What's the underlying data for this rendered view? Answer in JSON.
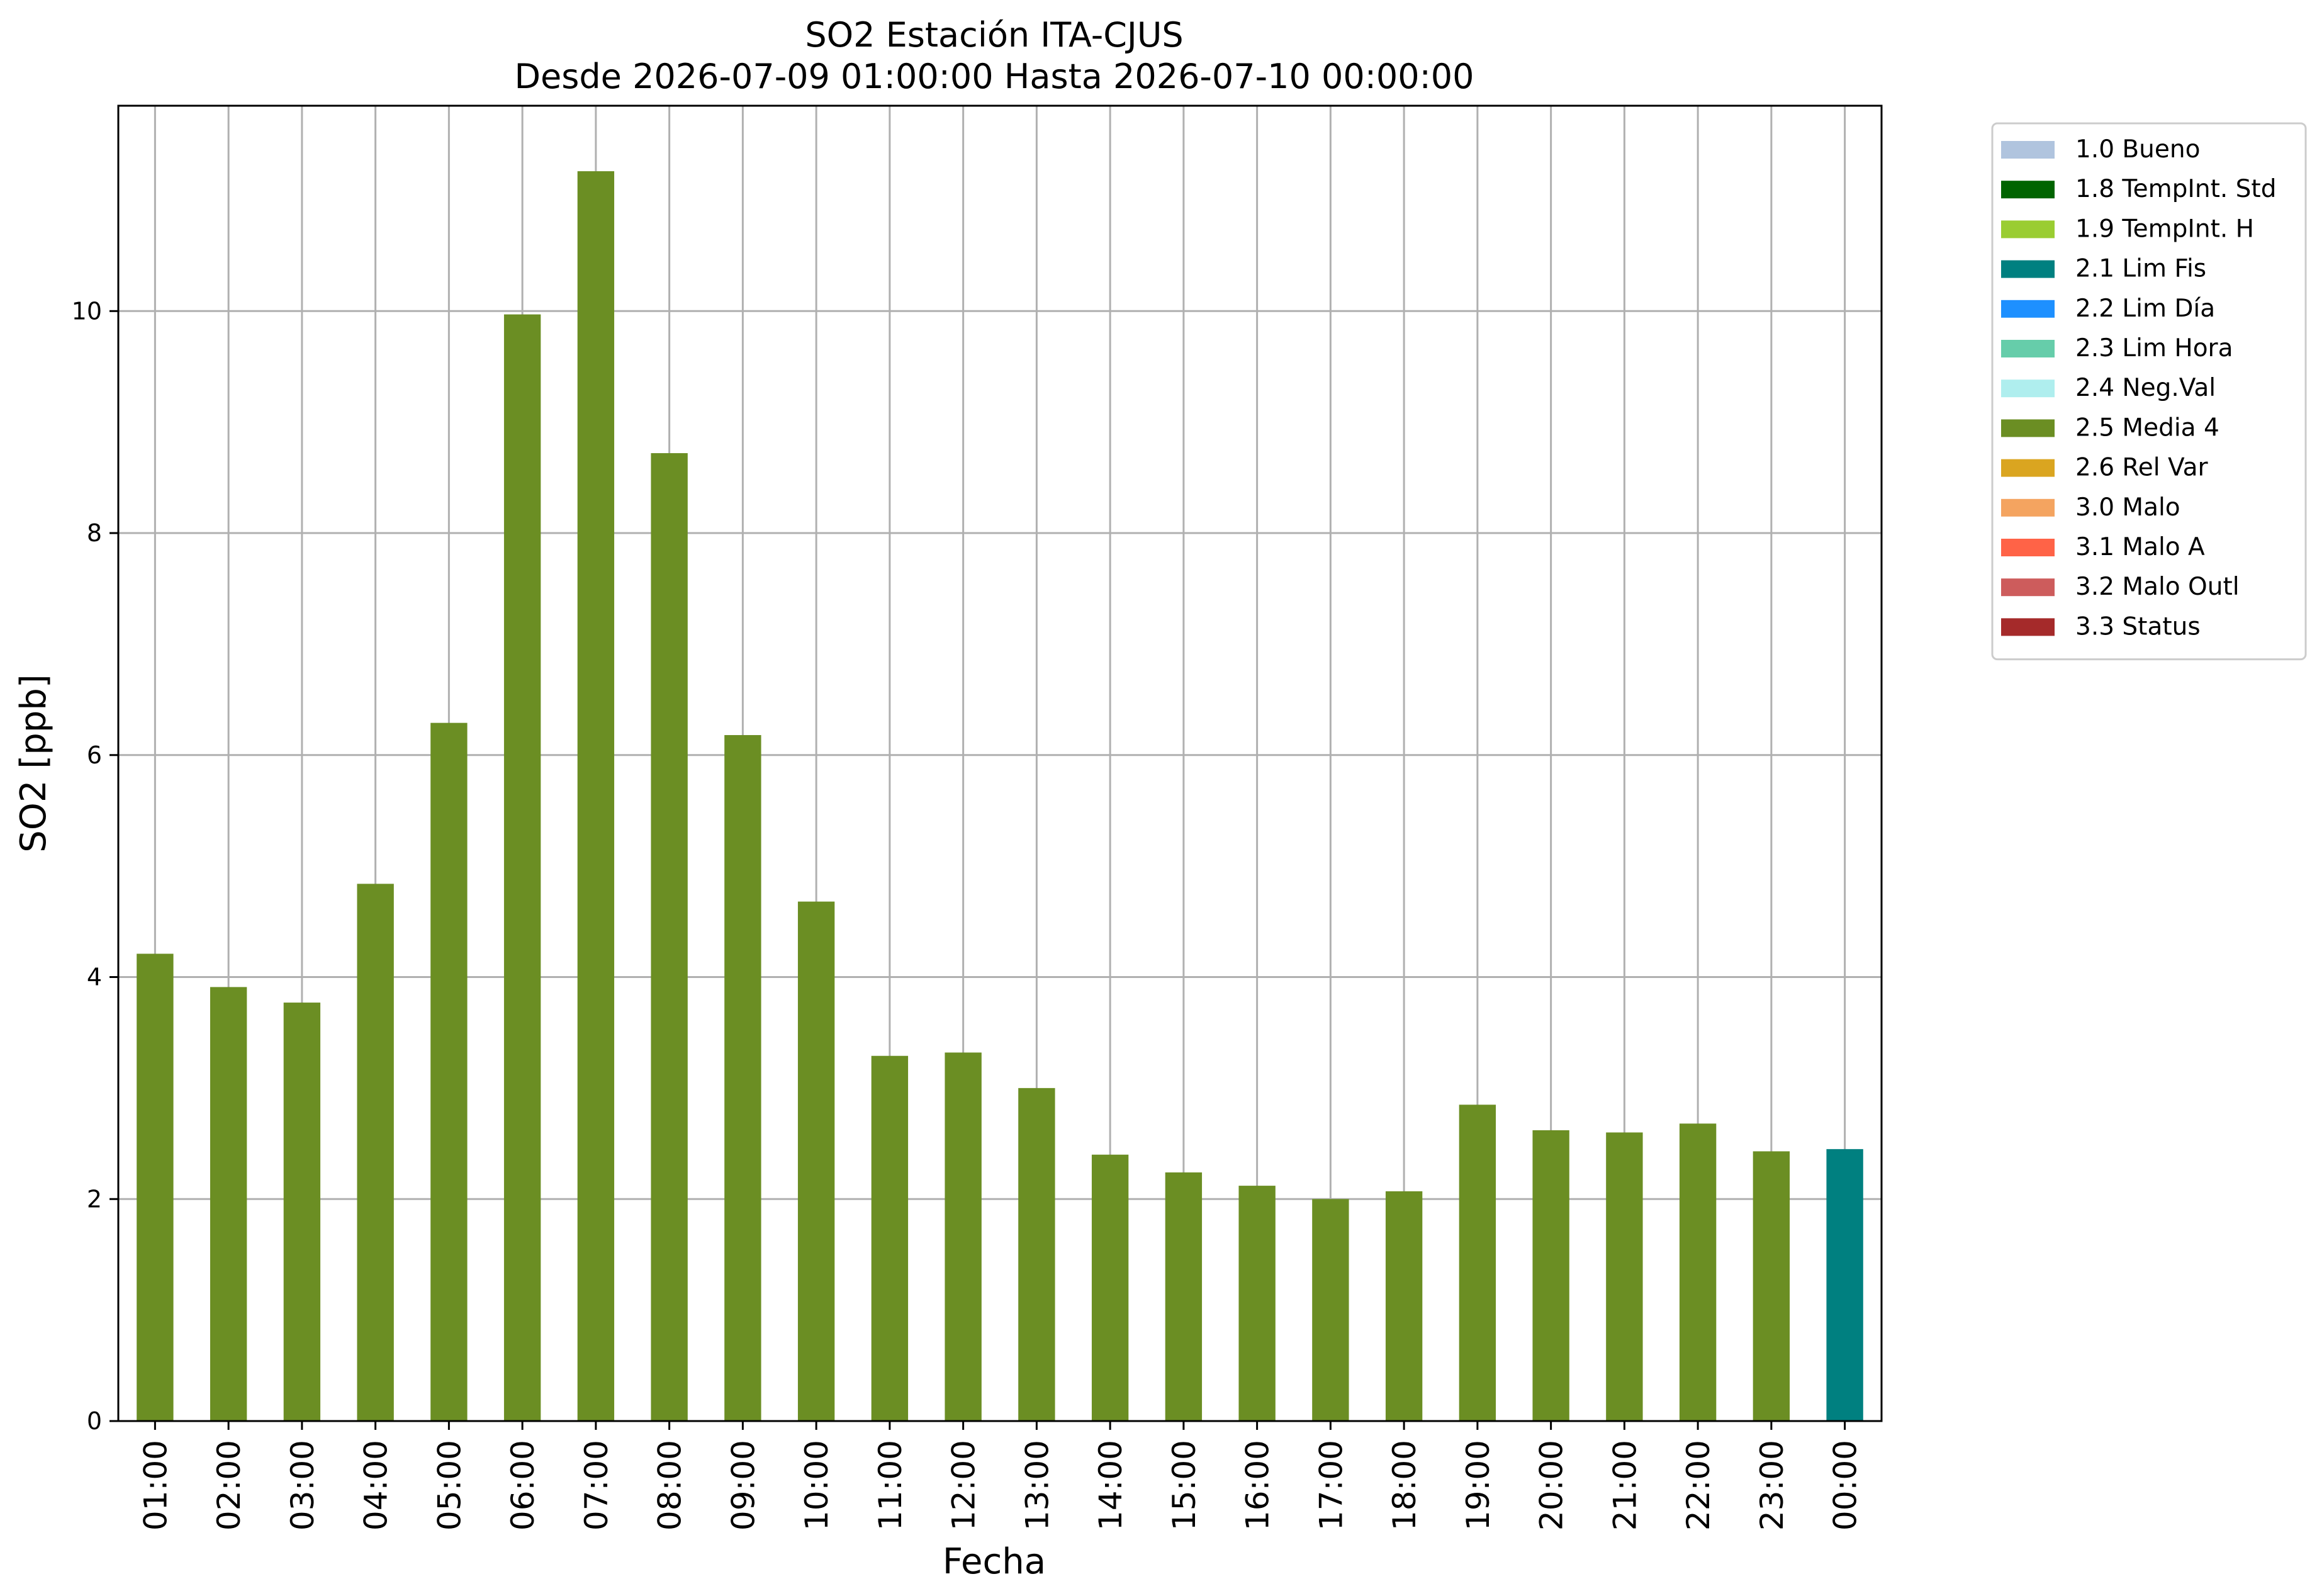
{
  "chart_data": {
    "type": "bar",
    "title": "SO2 Estación ITA-CJUS",
    "subtitle": "Desde 2026-07-09 01:00:00 Hasta 2026-07-10 00:00:00",
    "xlabel": "Fecha",
    "ylabel": "SO2 [ppb]",
    "ylim": [
      0,
      11.85
    ],
    "yticks": [
      0,
      2,
      4,
      6,
      8,
      10
    ],
    "grid": true,
    "legend_position": "outside-top-right",
    "categories": [
      "01:00",
      "02:00",
      "03:00",
      "04:00",
      "05:00",
      "06:00",
      "07:00",
      "08:00",
      "09:00",
      "10:00",
      "11:00",
      "12:00",
      "13:00",
      "14:00",
      "15:00",
      "16:00",
      "17:00",
      "18:00",
      "19:00",
      "20:00",
      "21:00",
      "22:00",
      "23:00",
      "00:00"
    ],
    "values": [
      4.21,
      3.91,
      3.77,
      4.84,
      6.29,
      9.97,
      11.26,
      8.72,
      6.18,
      4.68,
      3.29,
      3.32,
      3.0,
      2.4,
      2.24,
      2.12,
      2.0,
      2.07,
      2.85,
      2.62,
      2.6,
      2.68,
      2.43,
      2.45
    ],
    "bar_flags": [
      "2.5 Media 4",
      "2.5 Media 4",
      "2.5 Media 4",
      "2.5 Media 4",
      "2.5 Media 4",
      "2.5 Media 4",
      "2.5 Media 4",
      "2.5 Media 4",
      "2.5 Media 4",
      "2.5 Media 4",
      "2.5 Media 4",
      "2.5 Media 4",
      "2.5 Media 4",
      "2.5 Media 4",
      "2.5 Media 4",
      "2.5 Media 4",
      "2.5 Media 4",
      "2.5 Media 4",
      "2.5 Media 4",
      "2.5 Media 4",
      "2.5 Media 4",
      "2.5 Media 4",
      "2.5 Media 4",
      "2.1 Lim Fis"
    ],
    "legend": [
      {
        "label": "1.0 Bueno",
        "color": "#b0c4de"
      },
      {
        "label": "1.8 TempInt. Std",
        "color": "#006400"
      },
      {
        "label": "1.9 TempInt. H",
        "color": "#9acd32"
      },
      {
        "label": "2.1 Lim Fis",
        "color": "#008080"
      },
      {
        "label": "2.2 Lim Día",
        "color": "#1e90ff"
      },
      {
        "label": "2.3 Lim Hora",
        "color": "#66cdaa"
      },
      {
        "label": "2.4 Neg.Val",
        "color": "#afeeee"
      },
      {
        "label": "2.5 Media 4",
        "color": "#6b8e23"
      },
      {
        "label": "2.6 Rel Var",
        "color": "#daa520"
      },
      {
        "label": "3.0 Malo",
        "color": "#f4a460"
      },
      {
        "label": "3.1 Malo A",
        "color": "#ff6347"
      },
      {
        "label": "3.2 Malo Outl",
        "color": "#cd5c5c"
      },
      {
        "label": "3.3 Status",
        "color": "#a52a2a"
      }
    ]
  }
}
